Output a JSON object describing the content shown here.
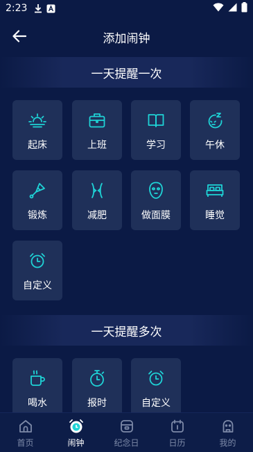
{
  "status_bar": {
    "time": "2:23"
  },
  "header": {
    "title": "添加闹钟"
  },
  "sections": {
    "once": {
      "title": "一天提醒一次"
    },
    "multi": {
      "title": "一天提醒多次"
    }
  },
  "once_items": [
    {
      "label": "起床",
      "icon": "sunrise-icon"
    },
    {
      "label": "上班",
      "icon": "briefcase-icon"
    },
    {
      "label": "学习",
      "icon": "book-icon"
    },
    {
      "label": "午休",
      "icon": "nap-icon"
    },
    {
      "label": "锻炼",
      "icon": "shuttlecock-icon"
    },
    {
      "label": "减肥",
      "icon": "waist-icon"
    },
    {
      "label": "做面膜",
      "icon": "face-mask-icon"
    },
    {
      "label": "睡觉",
      "icon": "bed-icon"
    },
    {
      "label": "自定义",
      "icon": "alarm-clock-icon"
    }
  ],
  "multi_items": [
    {
      "label": "喝水",
      "icon": "cup-icon"
    },
    {
      "label": "报时",
      "icon": "stopwatch-icon"
    },
    {
      "label": "自定义",
      "icon": "alarm-clock-icon"
    }
  ],
  "nav": [
    {
      "label": "首页",
      "icon": "home-icon",
      "active": false
    },
    {
      "label": "闹钟",
      "icon": "alarm-icon",
      "active": true
    },
    {
      "label": "纪念日",
      "icon": "anniversary-icon",
      "active": false
    },
    {
      "label": "日历",
      "icon": "calendar-icon",
      "active": false
    },
    {
      "label": "我的",
      "icon": "profile-icon",
      "active": false
    }
  ],
  "colors": {
    "accent": "#1fd3d6",
    "background": "#0b1a45",
    "tile": "#1f3059",
    "nav_inactive": "#7d8aa8"
  }
}
